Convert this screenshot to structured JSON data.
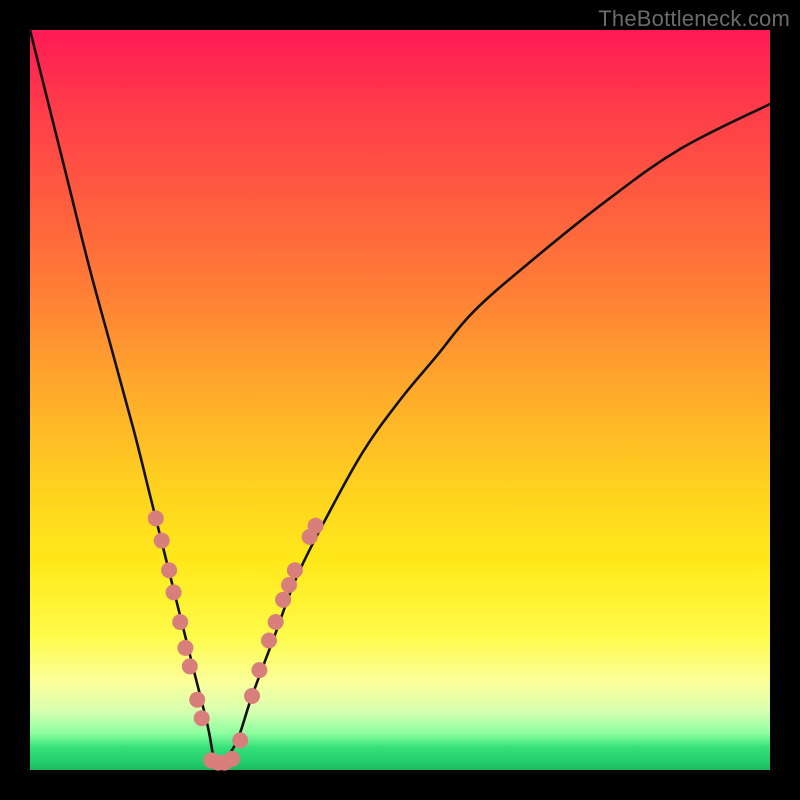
{
  "watermark": "TheBottleneck.com",
  "colors": {
    "frame": "#000000",
    "curve": "#111111",
    "dots": "#d87f7b",
    "gradient_top": "#ff1a55",
    "gradient_bottom": "#1cb85e"
  },
  "chart_data": {
    "type": "line",
    "title": "",
    "xlabel": "",
    "ylabel": "",
    "xlim": [
      0,
      100
    ],
    "ylim": [
      0,
      100
    ],
    "notes": "Bottleneck V curve. x approximates relative hardware balance (arbitrary units, 0-100). y approximates bottleneck severity percent (0 best at valley, 100 worst). Minimum near x≈25.",
    "series": [
      {
        "name": "bottleneck-curve",
        "x": [
          0,
          2,
          5,
          8,
          11,
          14,
          16,
          18,
          20,
          22,
          24,
          25,
          26,
          28,
          30,
          33,
          36,
          40,
          45,
          50,
          55,
          60,
          68,
          78,
          88,
          100
        ],
        "y": [
          100,
          92,
          80,
          68,
          57,
          46,
          38,
          30,
          22,
          14,
          6,
          1,
          1,
          4,
          10,
          18,
          26,
          34,
          43,
          50,
          56,
          62,
          69,
          77,
          84,
          90
        ]
      }
    ],
    "highlight_dots": {
      "name": "range-markers",
      "color": "#d87f7b",
      "points": [
        {
          "x": 17.0,
          "y": 34
        },
        {
          "x": 17.8,
          "y": 31
        },
        {
          "x": 18.8,
          "y": 27
        },
        {
          "x": 19.4,
          "y": 24
        },
        {
          "x": 20.3,
          "y": 20
        },
        {
          "x": 21.0,
          "y": 16.5
        },
        {
          "x": 21.6,
          "y": 14
        },
        {
          "x": 22.6,
          "y": 9.5
        },
        {
          "x": 23.2,
          "y": 7
        },
        {
          "x": 24.5,
          "y": 1.3
        },
        {
          "x": 25.4,
          "y": 1.0
        },
        {
          "x": 26.3,
          "y": 1.0
        },
        {
          "x": 27.3,
          "y": 1.5
        },
        {
          "x": 28.4,
          "y": 4
        },
        {
          "x": 30.0,
          "y": 10
        },
        {
          "x": 31.0,
          "y": 13.5
        },
        {
          "x": 32.3,
          "y": 17.5
        },
        {
          "x": 33.2,
          "y": 20
        },
        {
          "x": 34.2,
          "y": 23
        },
        {
          "x": 35.0,
          "y": 25
        },
        {
          "x": 35.8,
          "y": 27
        },
        {
          "x": 37.8,
          "y": 31.5
        },
        {
          "x": 38.6,
          "y": 33
        }
      ]
    }
  }
}
